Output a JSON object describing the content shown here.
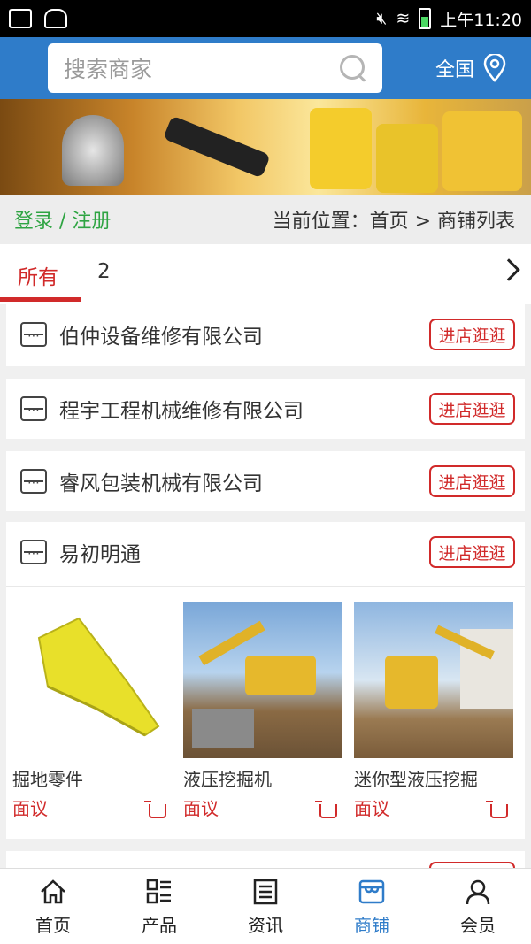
{
  "status_bar": {
    "time": "上午11:20"
  },
  "header": {
    "search_placeholder": "搜索商家",
    "region_label": "全国"
  },
  "breadcrumb_bar": {
    "login_label": "登录 / 注册",
    "location": "当前位置：首页 > 商铺列表"
  },
  "tabs": [
    {
      "label": "所有",
      "active": true
    },
    {
      "label": "2",
      "active": false
    }
  ],
  "shops": [
    {
      "name": "伯仲设备维修有限公司",
      "button": "进店逛逛"
    },
    {
      "name": "程宇工程机械维修有限公司",
      "button": "进店逛逛"
    },
    {
      "name": "睿风包装机械有限公司",
      "button": "进店逛逛"
    },
    {
      "name": "易初明通",
      "button": "进店逛逛",
      "products": [
        {
          "name": "掘地零件",
          "price": "面议",
          "image": "bucket-tooth"
        },
        {
          "name": "液压挖掘机",
          "price": "面议",
          "image": "excavator"
        },
        {
          "name": "迷你型液压挖掘",
          "price": "面议",
          "image": "mini-excavator"
        }
      ]
    }
  ],
  "tab_bar": [
    {
      "label": "首页",
      "icon": "home-icon",
      "active": false
    },
    {
      "label": "产品",
      "icon": "grid-list-icon",
      "active": false
    },
    {
      "label": "资讯",
      "icon": "news-icon",
      "active": false
    },
    {
      "label": "商铺",
      "icon": "shop-icon",
      "active": true
    },
    {
      "label": "会员",
      "icon": "user-icon",
      "active": false
    }
  ],
  "colors": {
    "primary": "#2f7cc9",
    "accent": "#d12a2a",
    "login_green": "#2ea442"
  }
}
